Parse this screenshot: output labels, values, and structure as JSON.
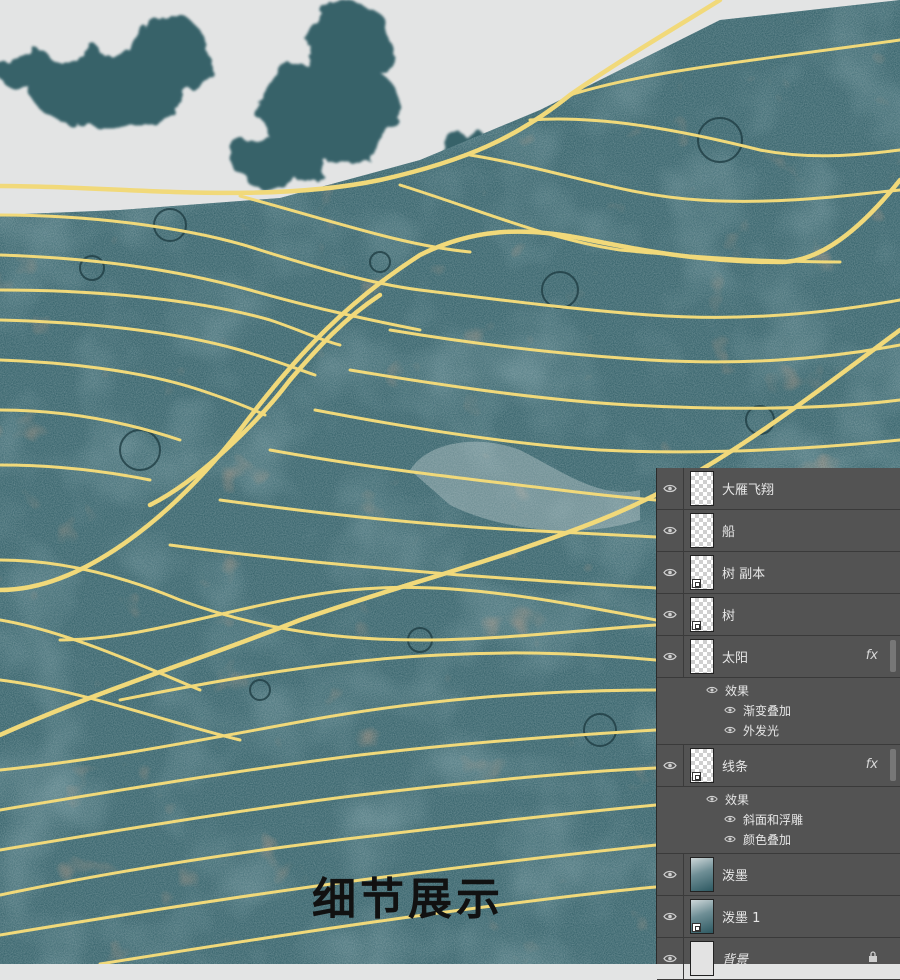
{
  "caption": "细节展示",
  "colors": {
    "background_paper": "#e3e4e4",
    "ink_teal": "#2e5962",
    "line_gold": "#f1d97a",
    "rust": "#8a4a2c",
    "panel": "#535353"
  },
  "layers_panel": {
    "layers": [
      {
        "name": "大雁飞翔",
        "thumb": "transparent",
        "smart": false,
        "fx": false
      },
      {
        "name": "船",
        "thumb": "transparent",
        "smart": false,
        "fx": false
      },
      {
        "name": "树 副本",
        "thumb": "transparent",
        "smart": true,
        "fx": false
      },
      {
        "name": "树",
        "thumb": "transparent",
        "smart": true,
        "fx": false
      },
      {
        "name": "太阳",
        "thumb": "transparent",
        "smart": false,
        "fx": true,
        "fx_label": "fx",
        "effects_label": "效果",
        "effects": [
          "渐变叠加",
          "外发光"
        ]
      },
      {
        "name": "线条",
        "thumb": "transparent",
        "smart": true,
        "fx": true,
        "fx_label": "fx",
        "effects_label": "效果",
        "effects": [
          "斜面和浮雕",
          "颜色叠加"
        ]
      },
      {
        "name": "泼墨",
        "thumb": "ink",
        "smart": false,
        "fx": false
      },
      {
        "name": "泼墨 1",
        "thumb": "ink",
        "smart": true,
        "fx": false
      },
      {
        "name": "背景",
        "thumb": "bg",
        "smart": false,
        "fx": false,
        "italic": true,
        "locked": true
      }
    ]
  }
}
